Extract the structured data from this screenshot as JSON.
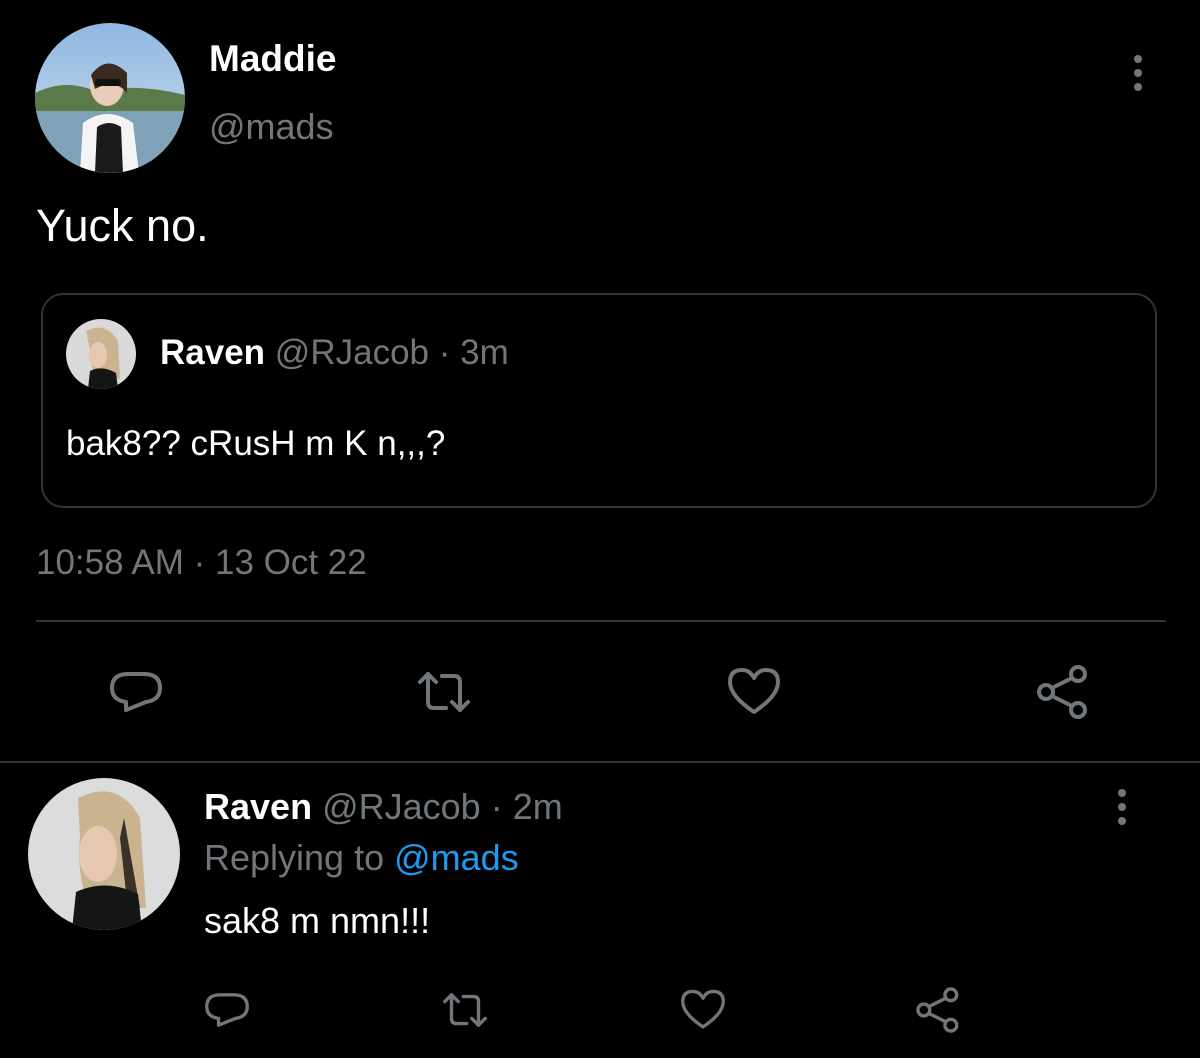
{
  "tweet": {
    "author_name": "Maddie",
    "author_handle": "@mads",
    "text": "Yuck no.",
    "timestamp": "10:58 AM · 13 Oct 22"
  },
  "quoted_tweet": {
    "author_name": "Raven",
    "author_handle": "@RJacob",
    "separator": "·",
    "age": "3m",
    "text": "bak8?? cRusH m K n,,,?"
  },
  "reply": {
    "author_name": "Raven",
    "author_handle": "@RJacob",
    "separator": "·",
    "age": "2m",
    "replying_prefix": "Replying to",
    "replying_to": "@mads",
    "text": "sak8 m nmn!!!"
  },
  "icons": {
    "more": "more-vertical-icon",
    "reply": "reply-icon",
    "retweet": "retweet-icon",
    "like": "heart-icon",
    "share": "share-icon"
  },
  "colors": {
    "background": "#000000",
    "text": "#ffffff",
    "secondary": "#71767b",
    "border": "#2f3336",
    "accent": "#1d9bf0"
  }
}
